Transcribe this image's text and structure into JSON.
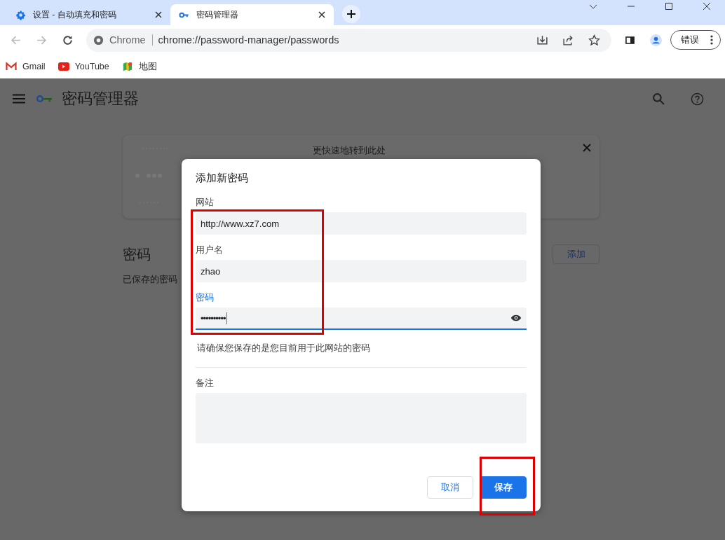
{
  "tabs": [
    {
      "title": "设置 - 自动填充和密码",
      "selected": false
    },
    {
      "title": "密码管理器",
      "selected": true
    }
  ],
  "toolbar": {
    "site_label": "Chrome",
    "url": "chrome://password-manager/passwords",
    "profile_button": "错误"
  },
  "bookmarks": [
    {
      "label": "Gmail"
    },
    {
      "label": "YouTube"
    },
    {
      "label": "地图"
    }
  ],
  "page": {
    "title": "密码管理器",
    "banner_text": "更快速地转到此处",
    "section_title": "密码",
    "add_button": "添加",
    "section_subtitle": "已保存的密码"
  },
  "dialog": {
    "title": "添加新密码",
    "fields_highlighted": true,
    "fields": [
      {
        "label": "网站",
        "value": "http://www.xz7.com",
        "kind": "text",
        "focused": false
      },
      {
        "label": "用户名",
        "value": "zhao",
        "kind": "text",
        "focused": false
      },
      {
        "label": "密码",
        "value": "••••••••••",
        "kind": "password",
        "focused": true
      }
    ],
    "hint": "请确保您保存的是您目前用于此网站的密码",
    "note_label": "备注",
    "buttons": [
      {
        "label": "取消",
        "kind": "secondary",
        "highlighted": false
      },
      {
        "label": "保存",
        "kind": "primary",
        "highlighted": true
      }
    ]
  }
}
